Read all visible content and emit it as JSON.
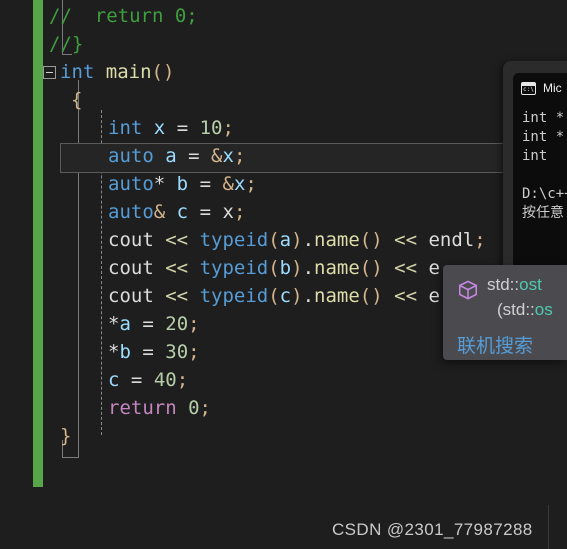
{
  "app": {
    "name": "visual-studio-code-editor",
    "theme_background": "#1e1e1e"
  },
  "editor": {
    "change_bar_color": "#57a64a",
    "current_line_index": 5,
    "lines": [
      {
        "index": 0,
        "text": "//  return 0;",
        "tokens": [
          {
            "t": "//  return 0;",
            "c": "t-comment"
          }
        ]
      },
      {
        "index": 1,
        "text": "//}",
        "tokens": [
          {
            "t": "//}",
            "c": "t-comment"
          }
        ]
      },
      {
        "index": 2,
        "text": "int main()",
        "tokens": [
          {
            "t": "int",
            "c": "t-kw"
          },
          {
            "t": " ",
            "c": "t-plain"
          },
          {
            "t": "main",
            "c": "t-fn"
          },
          {
            "t": "()",
            "c": "t-punc"
          }
        ]
      },
      {
        "index": 3,
        "text": "{",
        "tokens": [
          {
            "t": "{",
            "c": "t-punc"
          }
        ]
      },
      {
        "index": 4,
        "text": "int x = 10;",
        "tokens": [
          {
            "t": "int",
            "c": "t-kw"
          },
          {
            "t": " ",
            "c": "t-plain"
          },
          {
            "t": "x",
            "c": "t-var"
          },
          {
            "t": " ",
            "c": "t-plain"
          },
          {
            "t": "=",
            "c": "t-plain"
          },
          {
            "t": " ",
            "c": "t-plain"
          },
          {
            "t": "10",
            "c": "t-num"
          },
          {
            "t": ";",
            "c": "t-punc"
          }
        ]
      },
      {
        "index": 5,
        "text": "auto a = &x;",
        "tokens": [
          {
            "t": "auto",
            "c": "t-kw"
          },
          {
            "t": " ",
            "c": "t-plain"
          },
          {
            "t": "a",
            "c": "t-var"
          },
          {
            "t": " ",
            "c": "t-plain"
          },
          {
            "t": "=",
            "c": "t-plain"
          },
          {
            "t": " ",
            "c": "t-plain"
          },
          {
            "t": "&",
            "c": "t-punc"
          },
          {
            "t": "x",
            "c": "t-var"
          },
          {
            "t": ";",
            "c": "t-punc"
          }
        ]
      },
      {
        "index": 6,
        "text": "auto* b = &x;",
        "tokens": [
          {
            "t": "auto",
            "c": "t-kw"
          },
          {
            "t": "*",
            "c": "t-plain"
          },
          {
            "t": " ",
            "c": "t-plain"
          },
          {
            "t": "b",
            "c": "t-var"
          },
          {
            "t": " ",
            "c": "t-plain"
          },
          {
            "t": "=",
            "c": "t-plain"
          },
          {
            "t": " ",
            "c": "t-plain"
          },
          {
            "t": "&",
            "c": "t-punc"
          },
          {
            "t": "x",
            "c": "t-var"
          },
          {
            "t": ";",
            "c": "t-punc"
          }
        ]
      },
      {
        "index": 7,
        "text": "auto& c = x;",
        "tokens": [
          {
            "t": "auto",
            "c": "t-kw"
          },
          {
            "t": "&",
            "c": "t-punc"
          },
          {
            "t": " ",
            "c": "t-plain"
          },
          {
            "t": "c",
            "c": "t-var"
          },
          {
            "t": " ",
            "c": "t-plain"
          },
          {
            "t": "=",
            "c": "t-plain"
          },
          {
            "t": " ",
            "c": "t-plain"
          },
          {
            "t": "x",
            "c": "t-plain"
          },
          {
            "t": ";",
            "c": "t-punc"
          }
        ]
      },
      {
        "index": 8,
        "text": "cout << typeid(a).name() << endl;",
        "tokens": [
          {
            "t": "cout",
            "c": "t-plain"
          },
          {
            "t": " ",
            "c": "t-plain"
          },
          {
            "t": "<<",
            "c": "t-op"
          },
          {
            "t": " ",
            "c": "t-plain"
          },
          {
            "t": "typeid",
            "c": "t-kw"
          },
          {
            "t": "(",
            "c": "t-punc"
          },
          {
            "t": "a",
            "c": "t-var"
          },
          {
            "t": ")",
            "c": "t-punc"
          },
          {
            "t": ".",
            "c": "t-plain"
          },
          {
            "t": "name",
            "c": "t-fn"
          },
          {
            "t": "()",
            "c": "t-punc"
          },
          {
            "t": " ",
            "c": "t-plain"
          },
          {
            "t": "<<",
            "c": "t-op"
          },
          {
            "t": " ",
            "c": "t-plain"
          },
          {
            "t": "endl",
            "c": "t-plain"
          },
          {
            "t": ";",
            "c": "t-punc"
          }
        ]
      },
      {
        "index": 9,
        "text": "cout << typeid(b).name() << e",
        "tokens": [
          {
            "t": "cout",
            "c": "t-plain"
          },
          {
            "t": " ",
            "c": "t-plain"
          },
          {
            "t": "<<",
            "c": "t-op"
          },
          {
            "t": " ",
            "c": "t-plain"
          },
          {
            "t": "typeid",
            "c": "t-kw"
          },
          {
            "t": "(",
            "c": "t-punc"
          },
          {
            "t": "b",
            "c": "t-var"
          },
          {
            "t": ")",
            "c": "t-punc"
          },
          {
            "t": ".",
            "c": "t-plain"
          },
          {
            "t": "name",
            "c": "t-fn"
          },
          {
            "t": "()",
            "c": "t-punc"
          },
          {
            "t": " ",
            "c": "t-plain"
          },
          {
            "t": "<<",
            "c": "t-op"
          },
          {
            "t": " ",
            "c": "t-plain"
          },
          {
            "t": "e",
            "c": "t-plain"
          }
        ]
      },
      {
        "index": 10,
        "text": "cout << typeid(c).name() << e",
        "tokens": [
          {
            "t": "cout",
            "c": "t-plain"
          },
          {
            "t": " ",
            "c": "t-plain"
          },
          {
            "t": "<<",
            "c": "t-op"
          },
          {
            "t": " ",
            "c": "t-plain"
          },
          {
            "t": "typeid",
            "c": "t-kw"
          },
          {
            "t": "(",
            "c": "t-punc"
          },
          {
            "t": "c",
            "c": "t-var"
          },
          {
            "t": ")",
            "c": "t-punc"
          },
          {
            "t": ".",
            "c": "t-plain"
          },
          {
            "t": "name",
            "c": "t-fn"
          },
          {
            "t": "()",
            "c": "t-punc"
          },
          {
            "t": " ",
            "c": "t-plain"
          },
          {
            "t": "<<",
            "c": "t-op"
          },
          {
            "t": " ",
            "c": "t-plain"
          },
          {
            "t": "e",
            "c": "t-plain"
          }
        ]
      },
      {
        "index": 11,
        "text": "*a = 20;",
        "tokens": [
          {
            "t": "*",
            "c": "t-plain"
          },
          {
            "t": "a",
            "c": "t-var"
          },
          {
            "t": " ",
            "c": "t-plain"
          },
          {
            "t": "=",
            "c": "t-plain"
          },
          {
            "t": " ",
            "c": "t-plain"
          },
          {
            "t": "20",
            "c": "t-num"
          },
          {
            "t": ";",
            "c": "t-punc"
          }
        ]
      },
      {
        "index": 12,
        "text": "*b = 30;",
        "tokens": [
          {
            "t": "*",
            "c": "t-plain"
          },
          {
            "t": "b",
            "c": "t-var"
          },
          {
            "t": " ",
            "c": "t-plain"
          },
          {
            "t": "=",
            "c": "t-plain"
          },
          {
            "t": " ",
            "c": "t-plain"
          },
          {
            "t": "30",
            "c": "t-num"
          },
          {
            "t": ";",
            "c": "t-punc"
          }
        ]
      },
      {
        "index": 13,
        "text": "c = 40;",
        "tokens": [
          {
            "t": "c",
            "c": "t-var"
          },
          {
            "t": " ",
            "c": "t-plain"
          },
          {
            "t": "=",
            "c": "t-plain"
          },
          {
            "t": " ",
            "c": "t-plain"
          },
          {
            "t": "40",
            "c": "t-num"
          },
          {
            "t": ";",
            "c": "t-punc"
          }
        ]
      },
      {
        "index": 14,
        "text": "return 0;",
        "tokens": [
          {
            "t": "return",
            "c": "t-ctl"
          },
          {
            "t": " ",
            "c": "t-plain"
          },
          {
            "t": "0",
            "c": "t-num"
          },
          {
            "t": ";",
            "c": "t-punc"
          }
        ]
      },
      {
        "index": 15,
        "text": "}",
        "tokens": [
          {
            "t": "}",
            "c": "t-punc"
          }
        ]
      }
    ]
  },
  "console": {
    "icon": "cmd-prompt-icon",
    "title": "Mic",
    "output_lines": [
      "int *",
      "int *",
      "int",
      "",
      "D:\\c++",
      "按任意"
    ]
  },
  "tooltip": {
    "icon": "cube-icon",
    "signature_line1_prefix": "std::",
    "signature_line1_type": "ost",
    "signature_line2_prefix": "(std::",
    "signature_line2_type": "os",
    "search_link": "联机搜索"
  },
  "watermark": {
    "text": "CSDN @2301_77987288"
  }
}
